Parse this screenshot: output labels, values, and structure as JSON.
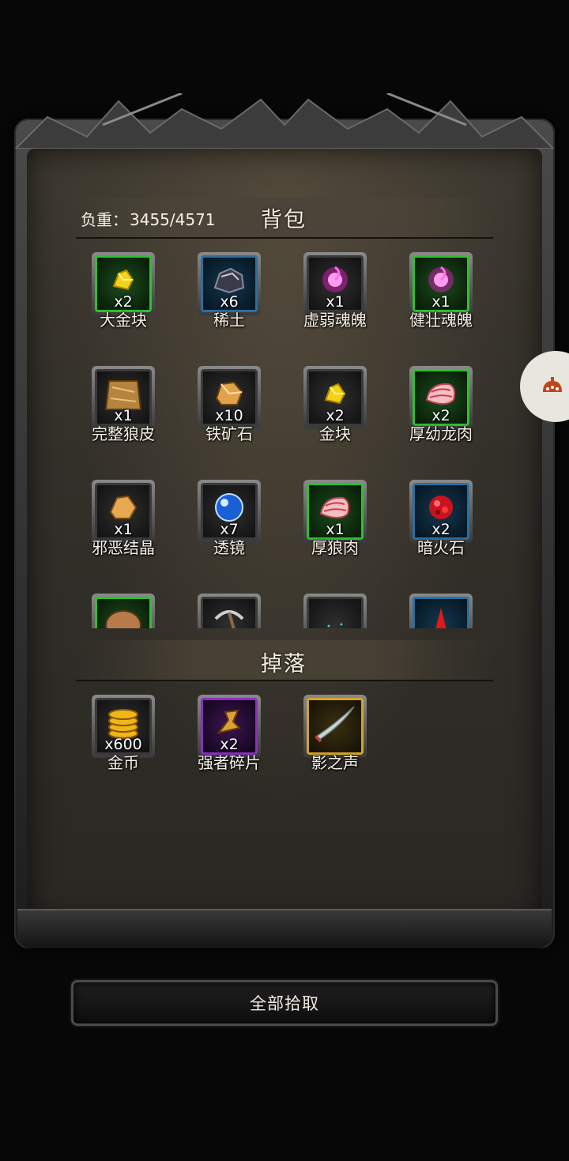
{
  "backpack": {
    "weight_label": "负重：",
    "weight_value": "3455/4571",
    "title": "背包",
    "items": [
      {
        "name": "大金块",
        "count": "x2",
        "quality": "green",
        "icon": "gold-nugget-icon"
      },
      {
        "name": "稀土",
        "count": "x6",
        "quality": "blue",
        "icon": "rare-earth-icon"
      },
      {
        "name": "虚弱魂魄",
        "count": "x1",
        "quality": "gray",
        "icon": "soul-orb-icon"
      },
      {
        "name": "健壮魂魄",
        "count": "x1",
        "quality": "green",
        "icon": "soul-orb-icon"
      },
      {
        "name": "完整狼皮",
        "count": "x1",
        "quality": "gray",
        "icon": "wolf-pelt-icon"
      },
      {
        "name": "铁矿石",
        "count": "x10",
        "quality": "gray",
        "icon": "iron-ore-icon"
      },
      {
        "name": "金块",
        "count": "x2",
        "quality": "gray",
        "icon": "gold-nugget-icon"
      },
      {
        "name": "厚幼龙肉",
        "count": "x2",
        "quality": "green",
        "icon": "meat-icon"
      },
      {
        "name": "邪恶结晶",
        "count": "x1",
        "quality": "gray",
        "icon": "crystal-icon"
      },
      {
        "name": "透镜",
        "count": "x7",
        "quality": "gray",
        "icon": "lens-icon"
      },
      {
        "name": "厚狼肉",
        "count": "x1",
        "quality": "green",
        "icon": "meat-icon"
      },
      {
        "name": "暗火石",
        "count": "x2",
        "quality": "blue",
        "icon": "fire-stone-icon"
      },
      {
        "name": "",
        "count": "",
        "quality": "green",
        "icon": "stone-icon"
      },
      {
        "name": "",
        "count": "",
        "quality": "gray",
        "icon": "pickaxe-icon"
      },
      {
        "name": "",
        "count": "",
        "quality": "gray",
        "icon": "sparkle-icon"
      },
      {
        "name": "",
        "count": "",
        "quality": "blue",
        "icon": "red-shard-icon"
      }
    ]
  },
  "drops": {
    "title": "掉落",
    "items": [
      {
        "name": "金币",
        "count": "x600",
        "quality": "gray",
        "icon": "gold-coins-icon"
      },
      {
        "name": "强者碎片",
        "count": "x2",
        "quality": "purple",
        "icon": "fragment-icon"
      },
      {
        "name": "影之声",
        "count": "",
        "quality": "yellow",
        "icon": "blade-icon"
      }
    ]
  },
  "actions": {
    "pickup_all": "全部拾取"
  },
  "colors": {
    "green": "#2fbf2f",
    "blue": "#2a6fa0",
    "purple": "#8a2fbf",
    "yellow": "#d1a52a"
  }
}
